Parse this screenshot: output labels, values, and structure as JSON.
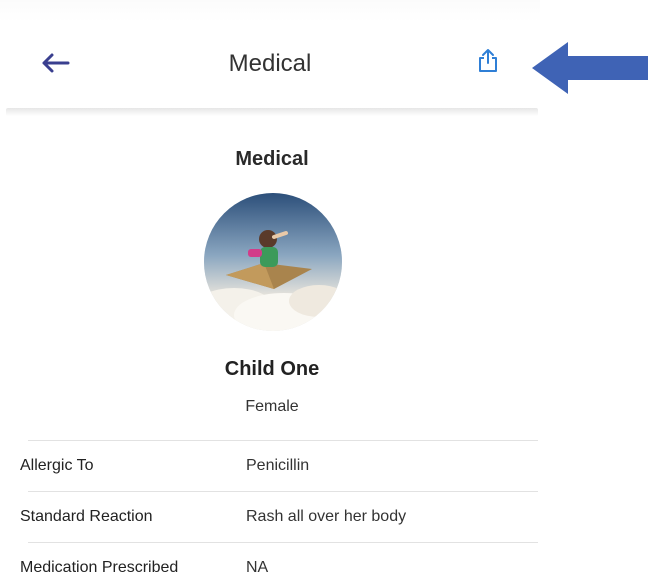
{
  "header": {
    "title": "Medical",
    "back_icon": "arrow-left-icon",
    "share_icon": "share-icon"
  },
  "profile": {
    "section_title": "Medical",
    "name": "Child One",
    "gender": "Female"
  },
  "info_rows": [
    {
      "label": "Allergic To",
      "value": "Penicillin"
    },
    {
      "label": "Standard Reaction",
      "value": "Rash all over her body"
    },
    {
      "label": "Medication Prescribed",
      "value": "NA"
    }
  ],
  "colors": {
    "back_arrow": "#3a3f8f",
    "share_icon": "#2f7fd6",
    "annotation_arrow": "#3f63b5"
  }
}
